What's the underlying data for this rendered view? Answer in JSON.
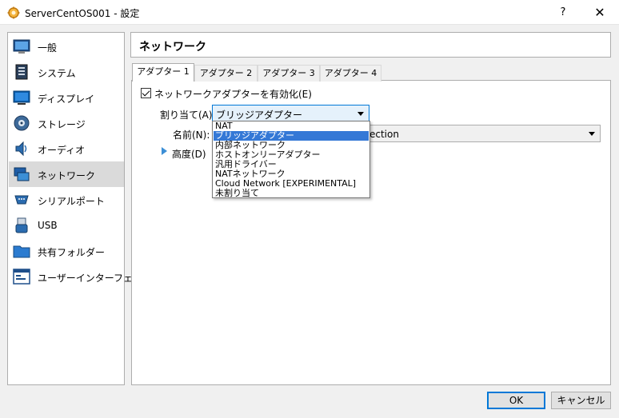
{
  "window": {
    "title": "ServerCentOS001 - 設定",
    "help_label": "?",
    "close_label": "✕"
  },
  "sidebar": {
    "items": [
      {
        "label": "一般",
        "icon": "general-icon"
      },
      {
        "label": "システム",
        "icon": "system-icon"
      },
      {
        "label": "ディスプレイ",
        "icon": "display-icon"
      },
      {
        "label": "ストレージ",
        "icon": "storage-icon"
      },
      {
        "label": "オーディオ",
        "icon": "audio-icon"
      },
      {
        "label": "ネットワーク",
        "icon": "network-icon",
        "selected": true
      },
      {
        "label": "シリアルポート",
        "icon": "serial-port-icon"
      },
      {
        "label": "USB",
        "icon": "usb-icon"
      },
      {
        "label": "共有フォルダー",
        "icon": "shared-folder-icon"
      },
      {
        "label": "ユーザーインターフェース",
        "icon": "user-interface-icon"
      }
    ]
  },
  "header": {
    "title": "ネットワーク"
  },
  "tabs": [
    {
      "label": "アダプター 1",
      "active": true
    },
    {
      "label": "アダプター 2"
    },
    {
      "label": "アダプター 3"
    },
    {
      "label": "アダプター 4"
    }
  ],
  "adapter": {
    "enable_label": "ネットワークアダプターを有効化(E)",
    "enabled": true,
    "attach_label": "割り当て(A):",
    "attach_value": "ブリッジアダプター",
    "name_label": "名前(N):",
    "name_value": "ection",
    "advanced_label": "高度(D)"
  },
  "dropdown": {
    "options": [
      "NAT",
      "ブリッジアダプター",
      "内部ネットワーク",
      "ホストオンリーアダプター",
      "汎用ドライバー",
      "NATネットワーク",
      "Cloud Network [EXPERIMENTAL]",
      "未割り当て"
    ],
    "selected_index": 1
  },
  "buttons": {
    "ok": "OK",
    "cancel": "キャンセル"
  },
  "colors": {
    "accent": "#0078d7",
    "selection": "#3478d6"
  }
}
